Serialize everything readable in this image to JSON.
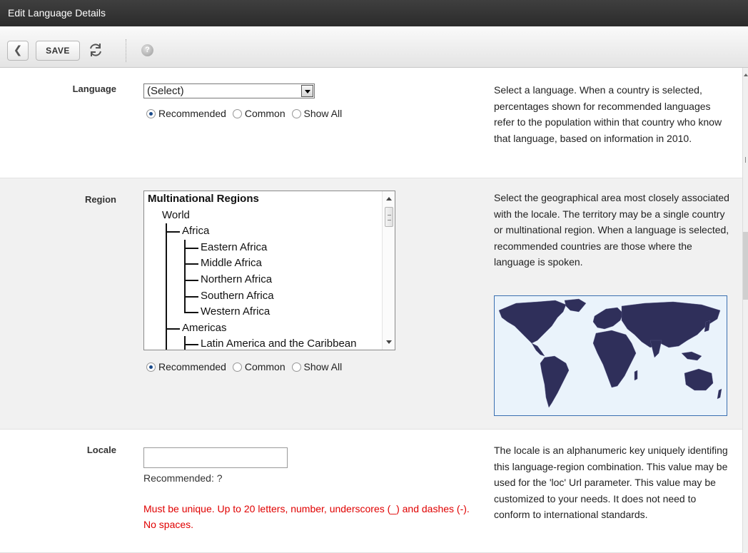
{
  "window": {
    "title": "Edit Language Details"
  },
  "toolbar": {
    "back_icon": "back-arrow-icon",
    "save_label": "SAVE",
    "refresh_icon": "refresh-icon",
    "help_icon": "help-icon",
    "help_glyph": "?"
  },
  "language": {
    "label": "Language",
    "select_value": "(Select)",
    "filters": [
      "Recommended",
      "Common",
      "Show All"
    ],
    "selected_filter": "Recommended",
    "help": "Select a language. When a country is selected, percentages shown for recommended languages refer to the population within that country who know that language, based on information in 2010."
  },
  "region": {
    "label": "Region",
    "items": [
      "Multinational Regions",
      "World",
      "Africa",
      "Eastern Africa",
      "Middle Africa",
      "Northern Africa",
      "Southern Africa",
      "Western Africa",
      "Americas",
      "Latin America and the Caribbean"
    ],
    "filters": [
      "Recommended",
      "Common",
      "Show All"
    ],
    "selected_filter": "Recommended",
    "help": "Select the geographical area most closely associated with the locale. The territory may be a single country or multinational region. When a language is selected, recommended countries are those where the language is spoken.",
    "map_colors": {
      "land": "#2f2f5a",
      "water": "#eaf3fb",
      "border": "#3a6fb0"
    }
  },
  "locale": {
    "label": "Locale",
    "input_value": "",
    "recommended": "Recommended: ?",
    "error": "Must be unique. Up to 20 letters, number, underscores (_) and dashes (-). No spaces.",
    "help": "The locale is an alphanumeric key uniquely identifing this language-region combination. This value may be used for the 'loc' Url parameter. This value may be customized to your needs. It does not need to conform to international standards."
  }
}
